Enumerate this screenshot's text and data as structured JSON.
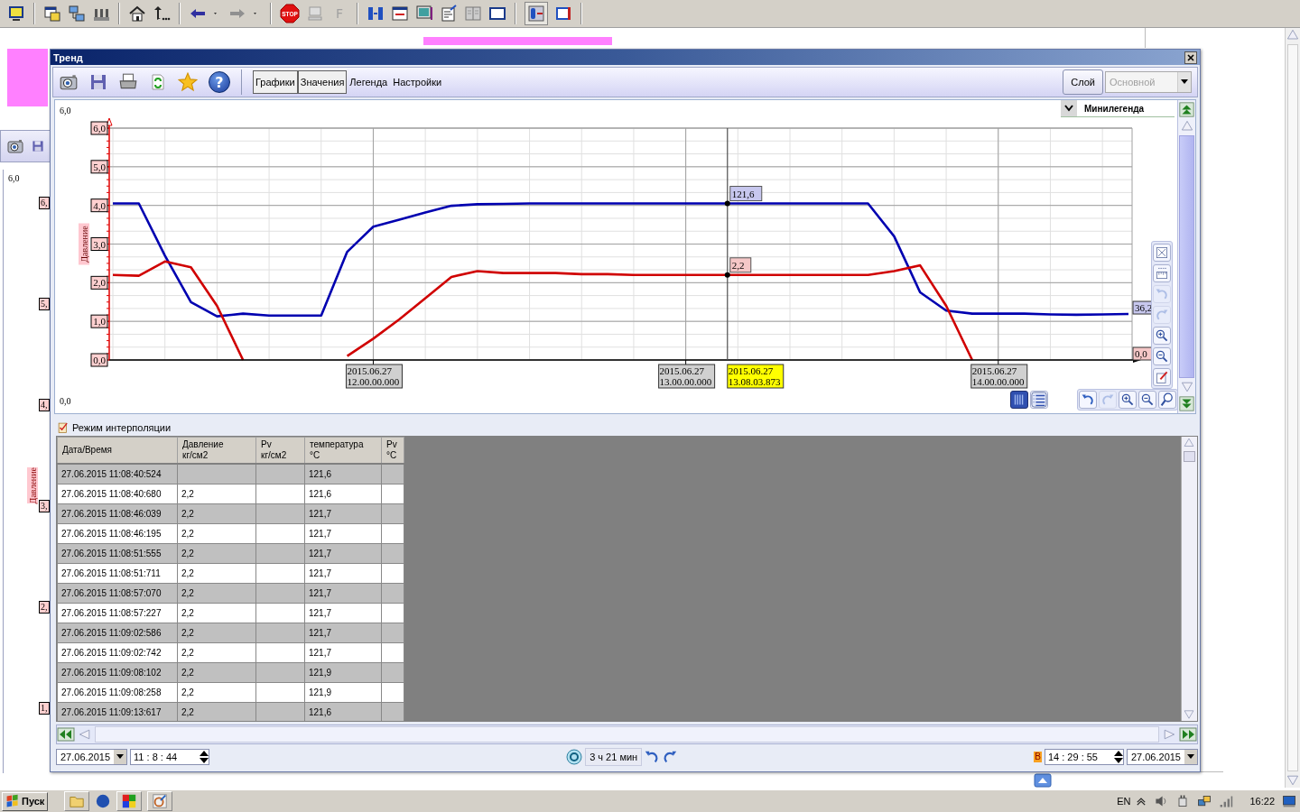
{
  "app_toolbar": {
    "stop_label": "STOP",
    "f_button": {
      "label": "F",
      "disabled": true
    }
  },
  "background_window": {
    "scale_max": "6,0",
    "axis_labels": [
      "6,",
      "5,",
      "4,",
      "3,",
      "2,",
      "1,"
    ],
    "ylabel": "Давление"
  },
  "window": {
    "title": "Тренд",
    "toolbar": {
      "help_label": "?",
      "tabs": [
        {
          "label": "Графики",
          "on": true
        },
        {
          "label": "Значения",
          "on": true
        },
        {
          "label": "Легенда",
          "on": false
        },
        {
          "label": "Настройки",
          "on": false
        }
      ],
      "layer_button": "Слой",
      "layer_select": {
        "value": "Основной",
        "disabled": true
      }
    },
    "chart": {
      "scale_max": "6,0",
      "scale_min": "0,0",
      "minilegend": "Минилегенда",
      "cursor": {
        "label": "2015.06.27 13.08.03.873",
        "values": [
          "121,6",
          "2,2"
        ]
      },
      "end_labels": [
        "36,2",
        "0,0"
      ],
      "chart_tools": [
        {
          "kind": "fit",
          "disabled": false
        },
        {
          "kind": "ruler",
          "disabled": false
        },
        {
          "kind": "undo",
          "disabled": true
        },
        {
          "kind": "redo",
          "disabled": true
        },
        {
          "kind": "zoom-in",
          "disabled": false
        },
        {
          "kind": "zoom-out",
          "disabled": false
        },
        {
          "kind": "note",
          "disabled": false
        }
      ],
      "view_buttons": [
        {
          "kind": "graph",
          "selected": true
        },
        {
          "kind": "list",
          "selected": false
        }
      ],
      "history_buttons": [
        {
          "kind": "undo",
          "disabled": false
        },
        {
          "kind": "redo",
          "disabled": true
        },
        {
          "kind": "zoom-in",
          "disabled": false
        },
        {
          "kind": "zoom-out",
          "disabled": false
        },
        {
          "kind": "magnifier",
          "disabled": false
        }
      ],
      "chart_data": {
        "type": "line",
        "ylabel": "Давление",
        "ylim": [
          0,
          6
        ],
        "grid": true,
        "categories": [
          null,
          null,
          null,
          null,
          null,
          null,
          null,
          null,
          null,
          null,
          "2015.06.27 12.00.00.000",
          null,
          null,
          null,
          null,
          null,
          null,
          null,
          null,
          null,
          null,
          null,
          "2015.06.27 13.00.00.000",
          null,
          null,
          null,
          null,
          null,
          null,
          null,
          null,
          null,
          null,
          null,
          "2015.06.27 14.00.00.000",
          null,
          null,
          null,
          null,
          null
        ],
        "yticks": [
          {
            "value": 0,
            "label": "0,0"
          },
          {
            "value": 1,
            "label": "1,0"
          },
          {
            "value": 2,
            "label": "2,0"
          },
          {
            "value": 3,
            "label": "3,0"
          },
          {
            "value": 4,
            "label": "4,0"
          },
          {
            "value": 5,
            "label": "5,0"
          },
          {
            "value": 6,
            "label": "6,0"
          }
        ],
        "series": [
          {
            "color": "#0000b0",
            "values": [
              4.05,
              4.05,
              2.7,
              1.5,
              1.13,
              1.2,
              1.15,
              1.15,
              1.15,
              2.8,
              3.45,
              3.63,
              3.82,
              3.99,
              4.03,
              4.04,
              4.05,
              4.05,
              4.05,
              4.05,
              4.05,
              4.05,
              4.05,
              4.05,
              4.05,
              4.05,
              4.05,
              4.05,
              4.05,
              4.05,
              3.2,
              1.75,
              1.28,
              1.2,
              1.2,
              1.2,
              1.18,
              1.17,
              1.18,
              1.19
            ]
          },
          {
            "color": "#d00000",
            "values": [
              2.2,
              2.18,
              2.55,
              2.4,
              1.4,
              0,
              null,
              null,
              null,
              0.1,
              0.55,
              1.05,
              1.6,
              2.15,
              2.3,
              2.25,
              2.25,
              2.25,
              2.22,
              2.22,
              2.2,
              2.2,
              2.2,
              2.2,
              2.2,
              2.2,
              2.2,
              2.2,
              2.2,
              2.2,
              2.3,
              2.45,
              1.4,
              0,
              null,
              null,
              null,
              null,
              null,
              null
            ]
          }
        ]
      }
    },
    "values": {
      "mode_label": "Режим интерполяции",
      "columns": [
        {
          "name": "Дата/Время"
        },
        {
          "name": "Давление",
          "unit": "кг/см2"
        },
        {
          "name": "Pv",
          "unit": "кг/см2"
        },
        {
          "name": "температура",
          "unit": "°C"
        },
        {
          "name": "Pv",
          "unit": "°C"
        }
      ],
      "rows": [
        [
          "27.06.2015 11:08:40:524",
          "",
          "",
          "121,6",
          ""
        ],
        [
          "27.06.2015 11:08:40:680",
          "2,2",
          "",
          "121,6",
          ""
        ],
        [
          "27.06.2015 11:08:46:039",
          "2,2",
          "",
          "121,7",
          ""
        ],
        [
          "27.06.2015 11:08:46:195",
          "2,2",
          "",
          "121,7",
          ""
        ],
        [
          "27.06.2015 11:08:51:555",
          "2,2",
          "",
          "121,7",
          ""
        ],
        [
          "27.06.2015 11:08:51:711",
          "2,2",
          "",
          "121,7",
          ""
        ],
        [
          "27.06.2015 11:08:57:070",
          "2,2",
          "",
          "121,7",
          ""
        ],
        [
          "27.06.2015 11:08:57:227",
          "2,2",
          "",
          "121,7",
          ""
        ],
        [
          "27.06.2015 11:09:02:586",
          "2,2",
          "",
          "121,7",
          ""
        ],
        [
          "27.06.2015 11:09:02:742",
          "2,2",
          "",
          "121,7",
          ""
        ],
        [
          "27.06.2015 11:09:08:102",
          "2,2",
          "",
          "121,9",
          ""
        ],
        [
          "27.06.2015 11:09:08:258",
          "2,2",
          "",
          "121,9",
          ""
        ],
        [
          "27.06.2015 11:09:13:617",
          "2,2",
          "",
          "121,6",
          ""
        ]
      ]
    },
    "bottom_bar": {
      "start_date": "27.06.2015",
      "start_time": "11 : 8 : 44",
      "duration": "3 ч 21 мин",
      "end_marker": "В",
      "end_time": "14 : 29 : 55",
      "end_date": "27.06.2015"
    }
  },
  "taskbar": {
    "start_label": "Пуск",
    "language": "EN",
    "clock": "16:22"
  }
}
